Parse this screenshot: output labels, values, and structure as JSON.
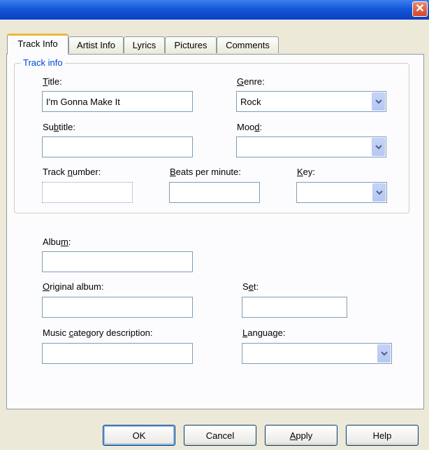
{
  "window": {
    "title": "",
    "close_glyph": "✕"
  },
  "tabs": [
    {
      "label": "Track Info",
      "active": true
    },
    {
      "label": "Artist Info",
      "active": false
    },
    {
      "label": "Lyrics",
      "active": false
    },
    {
      "label": "Pictures",
      "active": false
    },
    {
      "label": "Comments",
      "active": false
    }
  ],
  "group": {
    "legend": "Track info"
  },
  "fields": {
    "title": {
      "label_mn": "T",
      "label_rest": "itle:",
      "value": "I'm Gonna Make It"
    },
    "genre": {
      "label_mn": "G",
      "label_rest": "enre:",
      "value": "Rock"
    },
    "subtitle": {
      "label_pre": "Su",
      "label_mn": "b",
      "label_rest": "title:",
      "value": ""
    },
    "mood": {
      "label_pre": "Moo",
      "label_mn": "d",
      "label_rest": ":",
      "value": ""
    },
    "track_number": {
      "label_pre": "Track ",
      "label_mn": "n",
      "label_rest": "umber:",
      "value": ""
    },
    "bpm": {
      "label_mn": "B",
      "label_rest": "eats per minute:",
      "value": ""
    },
    "key": {
      "label_mn": "K",
      "label_rest": "ey:",
      "value": ""
    },
    "album": {
      "label_pre": "Albu",
      "label_mn": "m",
      "label_rest": ":",
      "value": ""
    },
    "original_album": {
      "label_mn": "O",
      "label_rest": "riginal album:",
      "value": ""
    },
    "set": {
      "label_pre": "S",
      "label_mn": "e",
      "label_rest": "t:",
      "value": ""
    },
    "music_category": {
      "label_pre": "Music ",
      "label_mn": "c",
      "label_rest": "ategory description:",
      "value": ""
    },
    "language": {
      "label_mn": "L",
      "label_rest": "anguage:",
      "value": ""
    }
  },
  "buttons": {
    "ok": "OK",
    "cancel": "Cancel",
    "apply_mn": "A",
    "apply_rest": "pply",
    "help": "Help"
  }
}
